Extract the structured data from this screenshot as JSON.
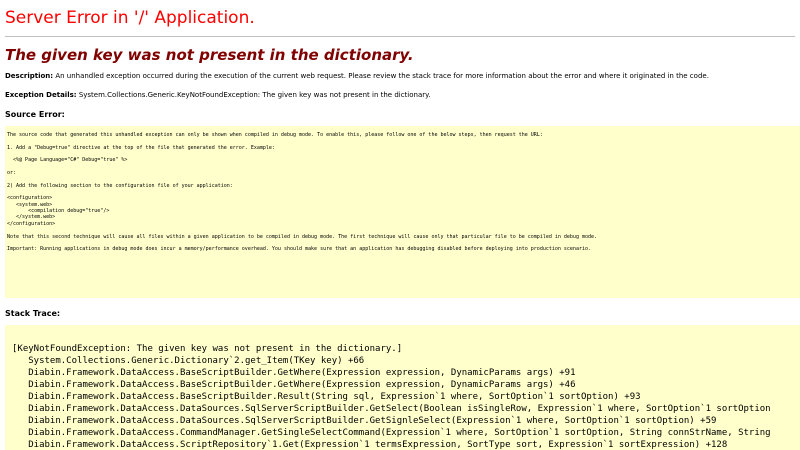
{
  "page": {
    "title": "Server Error in '/' Application.",
    "subtitle": "The given key was not present in the dictionary."
  },
  "description": {
    "label": "Description:",
    "text": "An unhandled exception occurred during the execution of the current web request. Please review the stack trace for more information about the error and where it originated in the code."
  },
  "exception": {
    "label": "Exception Details:",
    "text": "System.Collections.Generic.KeyNotFoundException: The given key was not present in the dictionary."
  },
  "source_error": {
    "heading": "Source Error:",
    "lines": [
      "The source code that generated this unhandled exception can only be shown when compiled in debug mode. To enable this, please follow one of the below steps, then request the URL:",
      "",
      "1. Add a \"Debug=true\" directive at the top of the file that generated the error. Example:",
      "",
      "  <%@ Page Language=\"C#\" Debug=\"true\" %>",
      "",
      "or:",
      "",
      "2) Add the following section to the configuration file of your application:",
      "",
      "<configuration>",
      "   <system.web>",
      "       <compilation debug=\"true\"/>",
      "   </system.web>",
      "</configuration>",
      "",
      "Note that this second technique will cause all files within a given application to be compiled in debug mode. The first technique will cause only that particular file to be compiled in debug mode.",
      "",
      "Important: Running applications in debug mode does incur a memory/performance overhead. You should make sure that an application has debugging disabled before deploying into production scenario."
    ]
  },
  "stack_trace": {
    "heading": "Stack Trace:",
    "lines": [
      "[KeyNotFoundException: The given key was not present in the dictionary.]",
      "   System.Collections.Generic.Dictionary`2.get_Item(TKey key) +66",
      "   Diabin.Framework.DataAccess.BaseScriptBuilder.GetWhere(Expression expression, DynamicParams args) +91",
      "   Diabin.Framework.DataAccess.BaseScriptBuilder.GetWhere(Expression expression, DynamicParams args) +46",
      "   Diabin.Framework.DataAccess.BaseScriptBuilder.Result(String sql, Expression`1 where, SortOption`1 sortOption) +93",
      "   Diabin.Framework.DataAccess.DataSources.SqlServerScriptBuilder.GetSelect(Boolean isSingleRow, Expression`1 where, SortOption`1 sortOption",
      "   Diabin.Framework.DataAccess.DataSources.SqlServerScriptBuilder.GetSignleSelect(Expression`1 where, SortOption`1 sortOption) +59",
      "   Diabin.Framework.DataAccess.CommandManager.GetSingleSelectCommand(Expression`1 where, SortOption`1 sortOption, String connStrName, String",
      "   Diabin.Framework.DataAccess.ScriptRepository`1.Get(Expression`1 termsExpression, SortType sort, Expression`1 sortExpression) +128"
    ]
  }
}
